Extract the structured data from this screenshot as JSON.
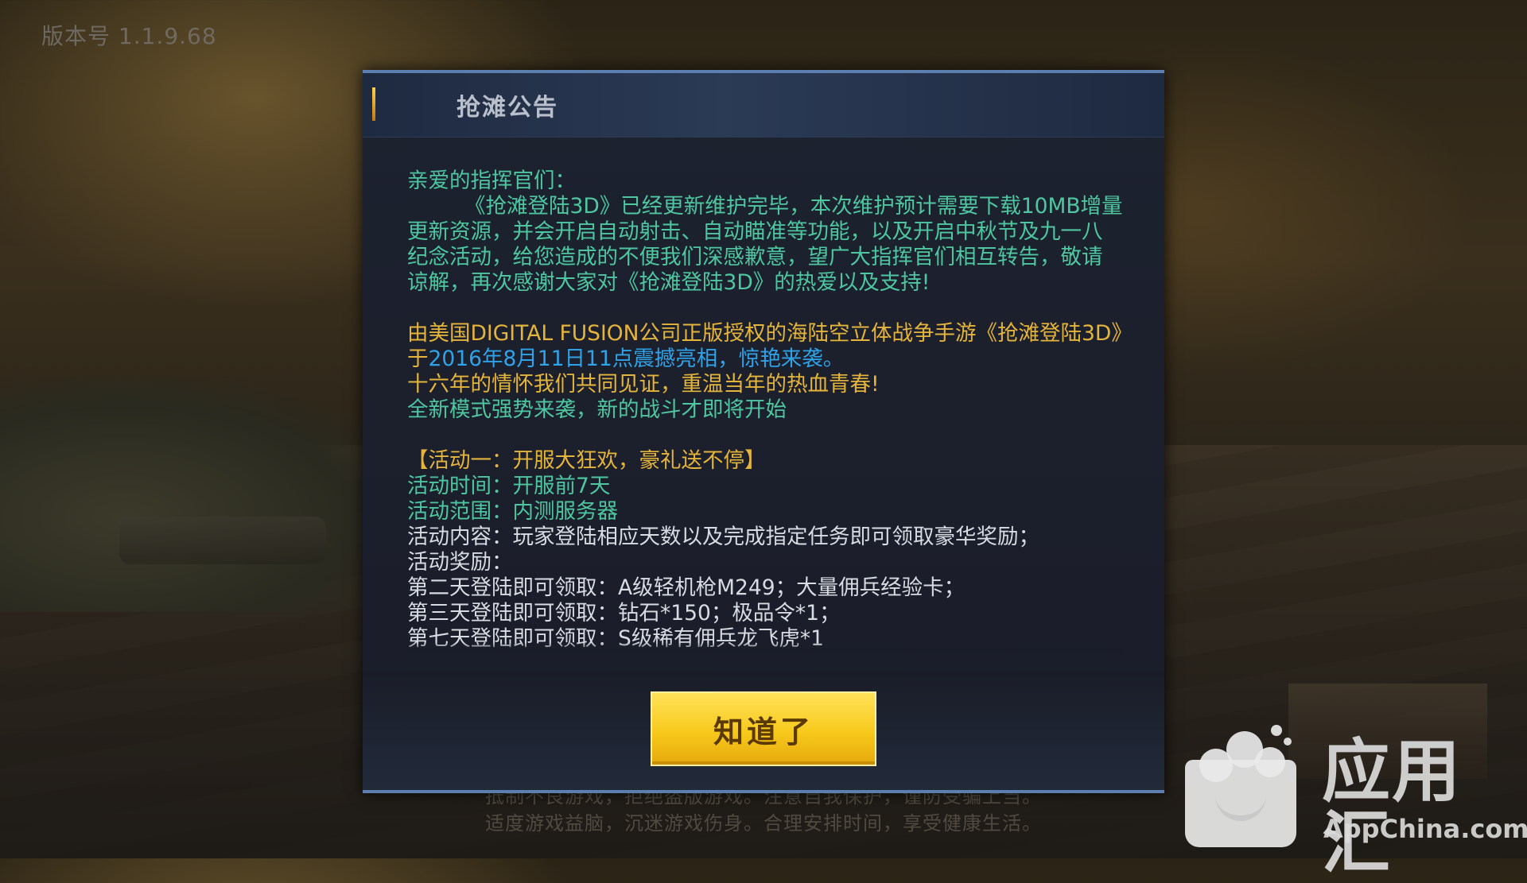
{
  "version_label": "版本号 1.1.9.68",
  "dialog": {
    "title": "抢滩公告",
    "greeting": "亲爱的指挥官们：",
    "paragraph1": "《抢滩登陆3D》已经更新维护完毕，本次维护预计需要下载10MB增量更新资源，并会开启自动射击、自动瞄准等功能，以及开启中秋节及九一八纪念活动，给您造成的不便我们深感歉意，望广大指挥官们相互转告，敬请谅解，再次感谢大家对《抢滩登陆3D》的热爱以及支持!",
    "launch_text": "由美国DIGITAL FUSION公司正版授权的海陆空立体战争手游《抢滩登陆3D》于",
    "launch_highlight": "2016年8月11日11点震撼亮相，惊艳来袭。",
    "line_sixteen_years": "十六年的情怀我们共同见证，重温当年的热血青春!",
    "line_new_mode": "全新模式强势来袭，新的战斗才即将开始",
    "event_title": "【活动一：开服大狂欢，豪礼送不停】",
    "event_time": "活动时间：开服前7天",
    "event_scope": "活动范围：内测服务器",
    "event_content": "活动内容：玩家登陆相应天数以及完成指定任务即可领取豪华奖励；",
    "event_reward_label": "活动奖励：",
    "reward_day2": "第二天登陆即可领取：A级轻机枪M249；大量佣兵经验卡；",
    "reward_day3": "第三天登陆即可领取：钻石*150；极品令*1；",
    "reward_day7_partial": "第七天登陆即可领取：S级稀有佣兵龙飞虎*1",
    "confirm_label": "知道了"
  },
  "background_footer": {
    "line1": "抵制不良游戏，拒绝盗版游戏。注意自我保护，谨防受骗上当。",
    "line2": "适度游戏益脑，沉迷游戏伤身。合理安排时间，享受健康生活。"
  },
  "watermark": {
    "name": "应用汇",
    "english": "AppChina.com"
  },
  "colors": {
    "green_text": "#4ec7a0",
    "gold_text": "#e5b43b",
    "blue_highlight": "#2fa2e8",
    "button_yellow": "#f7c91c",
    "dialog_border": "#5d7fb0"
  }
}
